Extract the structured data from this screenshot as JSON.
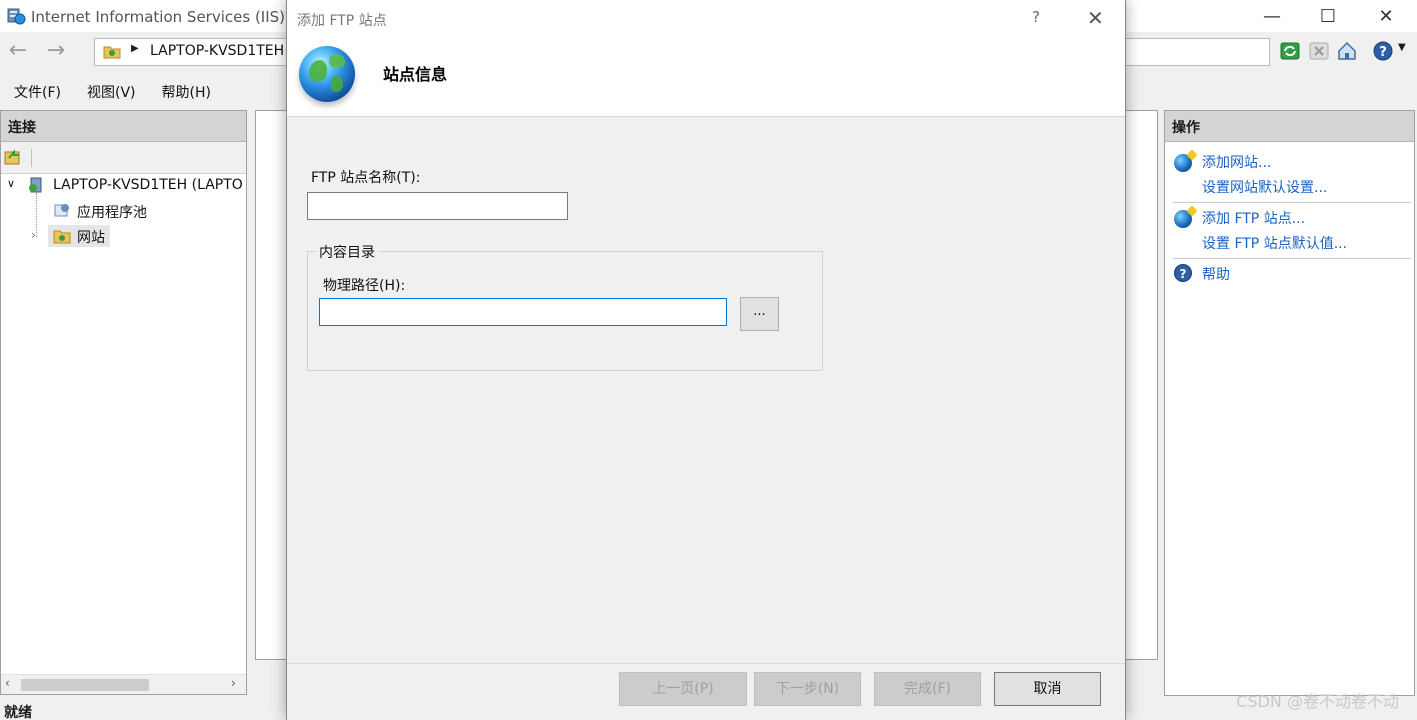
{
  "main_window": {
    "title": "Internet Information Services (IIS)管",
    "address_crumb": "LAPTOP-KVSD1TEH",
    "menus": [
      "文件(F)",
      "视图(V)",
      "帮助(H)"
    ],
    "connections": {
      "header": "连接",
      "tree": {
        "server": "LAPTOP-KVSD1TEH (LAPTO",
        "app_pools": "应用程序池",
        "sites": "网站"
      }
    },
    "actions": {
      "header": "操作",
      "add_site": "添加网站...",
      "site_defaults": "设置网站默认设置...",
      "add_ftp_site": "添加 FTP 站点...",
      "ftp_defaults": "设置 FTP 站点默认值...",
      "help": "帮助"
    },
    "status": "就绪",
    "watermark": "CSDN @卷不动卷不动"
  },
  "dialog": {
    "title": "添加 FTP 站点",
    "help_glyph": "?",
    "header": "站点信息",
    "site_name_label": "FTP 站点名称(T):",
    "site_name_value": "",
    "content_dir_legend": "内容目录",
    "physical_path_label": "物理路径(H):",
    "physical_path_value": "",
    "browse_label": "...",
    "buttons": {
      "prev": "上一页(P)",
      "next": "下一步(N)",
      "finish": "完成(F)",
      "cancel": "取消"
    }
  },
  "colors": {
    "link": "#1b62c6",
    "focus_border": "#0078d7",
    "pane_header": "#d4d4d4"
  }
}
